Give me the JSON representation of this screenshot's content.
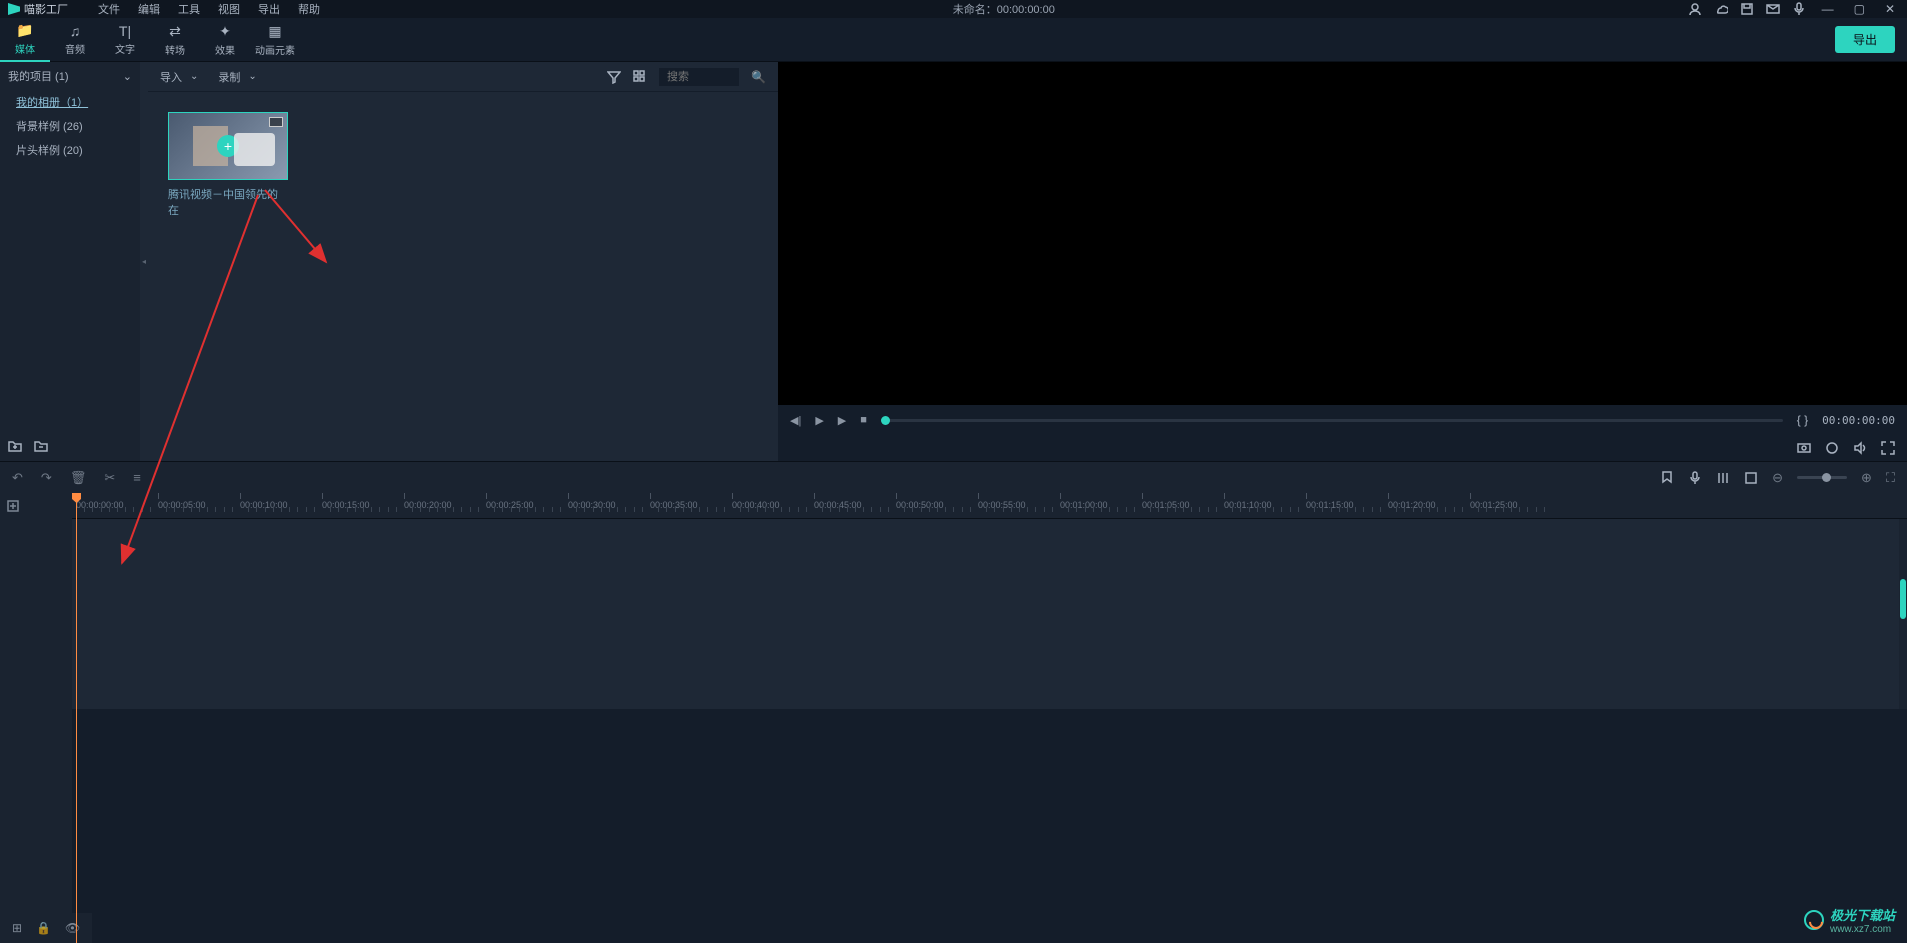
{
  "titlebar": {
    "app_name": "喵影工厂",
    "menus": [
      "文件",
      "编辑",
      "工具",
      "视图",
      "导出",
      "帮助"
    ],
    "center": "未命名：00:00:00:00"
  },
  "toolbar": {
    "tabs": [
      {
        "label": "媒体",
        "icon": "folder"
      },
      {
        "label": "音频",
        "icon": "music"
      },
      {
        "label": "文字",
        "icon": "text"
      },
      {
        "label": "转场",
        "icon": "transition"
      },
      {
        "label": "效果",
        "icon": "effects"
      },
      {
        "label": "动画元素",
        "icon": "animation"
      }
    ],
    "export_label": "导出"
  },
  "sidebar": {
    "header": "我的项目 (1)",
    "items": [
      {
        "label": "我的相册（1）",
        "active": true
      },
      {
        "label": "背景样例 (26)",
        "active": false
      },
      {
        "label": "片头样例 (20)",
        "active": false
      }
    ]
  },
  "media_panel": {
    "dropdowns": [
      "导入",
      "录制"
    ],
    "search_placeholder": "搜索",
    "item_label": "腾讯视频－中国领先的在"
  },
  "preview": {
    "time": "00:00:00:00",
    "markers": "{  }"
  },
  "timeline": {
    "ticks": [
      "00:00:00:00",
      "00:00:05:00",
      "00:00:10:00",
      "00:00:15:00",
      "00:00:20:00",
      "00:00:25:00",
      "00:00:30:00",
      "00:00:35:00",
      "00:00:40:00",
      "00:00:45:00",
      "00:00:50:00",
      "00:00:55:00",
      "00:01:00:00",
      "00:01:05:00",
      "00:01:10:00",
      "00:01:15:00",
      "00:01:20:00",
      "00:01:25:00"
    ]
  },
  "watermark": {
    "text": "极光下载站",
    "url": "www.xz7.com"
  }
}
